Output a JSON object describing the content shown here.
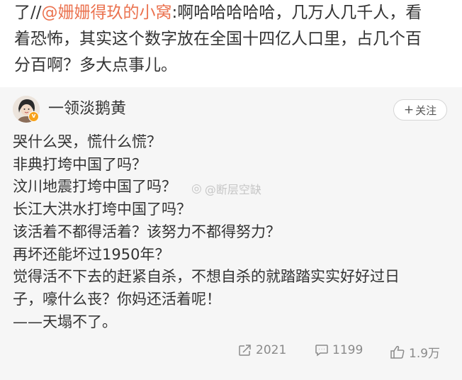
{
  "repost": {
    "prefix": "了//",
    "mention": "@姗姗得玖的小窝",
    "text_line1_rest": ":啊哈哈哈哈哈，几万人几千人，看",
    "text_line2": "着恐怖，其实这个数字放在全国十四亿人口里，占几个百",
    "text_line3": "分百啊？多大点事儿。"
  },
  "original": {
    "author": "一领淡鹅黄",
    "follow_label": "关注",
    "lines": [
      "哭什么哭，慌什么慌？",
      "非典打垮中国了吗？",
      "汶川地震打垮中国了吗？",
      "长江大洪水打垮中国了吗？",
      "该活着不都得活着？该努力不都得努力？",
      "再坏还能坏过1950年？",
      "觉得活不下去的赶紧自杀，不想自杀的就踏踏实实好好过日",
      "子，嚎什么丧？你妈还活着呢！",
      "——天塌不了。"
    ],
    "watermark": "@断层空缺"
  },
  "actions": {
    "reposts": "2021",
    "comments": "1199",
    "likes": "1.9万"
  },
  "colors": {
    "mention": "#eb7350",
    "card_bg": "#f6f6f6",
    "verified_badge": "#f7a21b"
  },
  "icons": [
    "repost-icon",
    "comment-icon",
    "like-icon",
    "verified-badge-icon",
    "weibo-watermark-icon"
  ]
}
